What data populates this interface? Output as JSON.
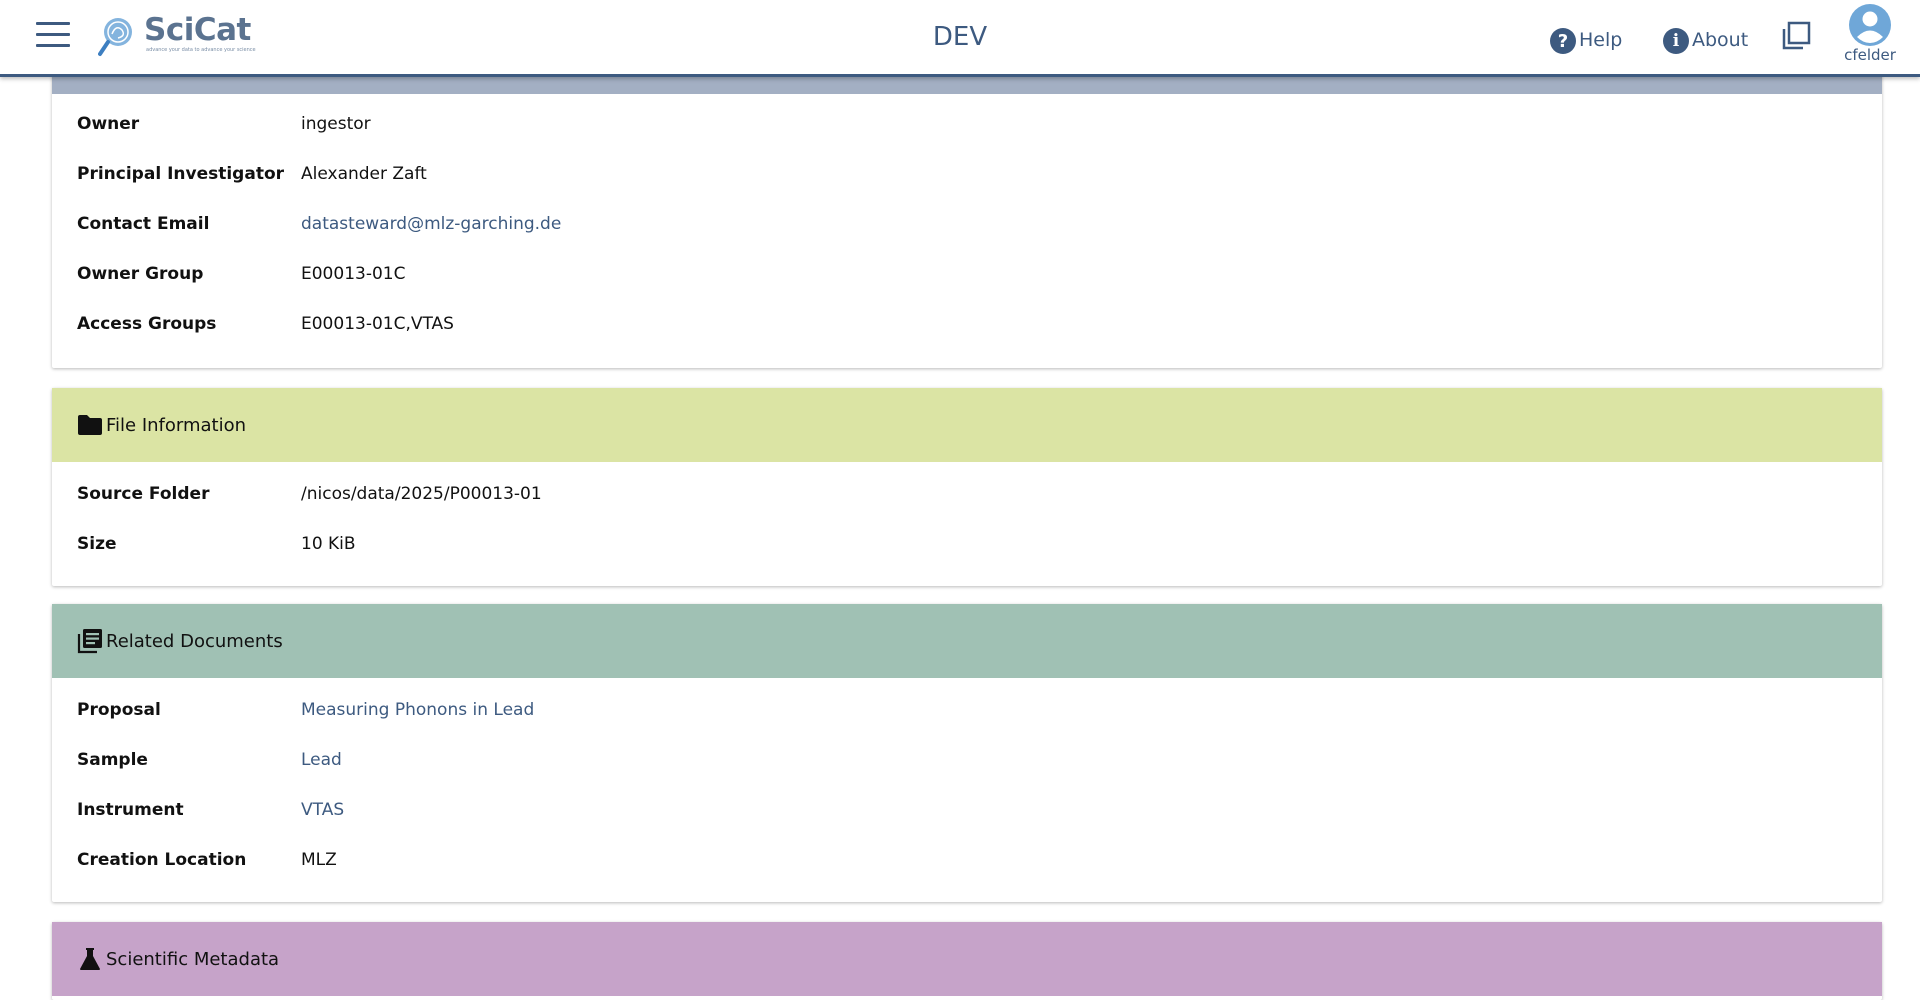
{
  "header": {
    "logo_sci": "Sci",
    "logo_cat": "Cat",
    "logo_tagline": "advance your data to advance your science",
    "site_title": "DEV",
    "help_label": "Help",
    "about_label": "About",
    "user_name": "cfelder"
  },
  "ownership": {
    "rows": [
      {
        "label": "Owner",
        "value": "ingestor"
      },
      {
        "label": "Principal Investigator",
        "value": "Alexander Zaft"
      },
      {
        "label": "Contact Email",
        "value": "datasteward@mlz-garching.de"
      },
      {
        "label": "Owner Group",
        "value": "E00013-01C"
      },
      {
        "label": "Access Groups",
        "value": "E00013-01C,VTAS"
      }
    ]
  },
  "file_info": {
    "title": "File Information",
    "icon": "folder-icon",
    "rows": [
      {
        "label": "Source Folder",
        "value": "/nicos/data/2025/P00013-01"
      },
      {
        "label": "Size",
        "value": "10 KiB"
      }
    ]
  },
  "related_docs": {
    "title": "Related Documents",
    "icon": "documents-icon",
    "rows": [
      {
        "label": "Proposal",
        "value": "Measuring Phonons in Lead"
      },
      {
        "label": "Sample",
        "value": "Lead"
      },
      {
        "label": "Instrument",
        "value": "VTAS"
      },
      {
        "label": "Creation Location",
        "value": "MLZ"
      }
    ]
  },
  "scientific_metadata": {
    "title": "Scientific Metadata",
    "icon": "flask-icon"
  },
  "colors": {
    "primary": "#3d5a80",
    "ownership_header": "#a3afc3",
    "file_info_header": "#dbe4a4",
    "related_docs_header": "#a0c1b4",
    "scientific_metadata_header": "#c6a3c9"
  }
}
